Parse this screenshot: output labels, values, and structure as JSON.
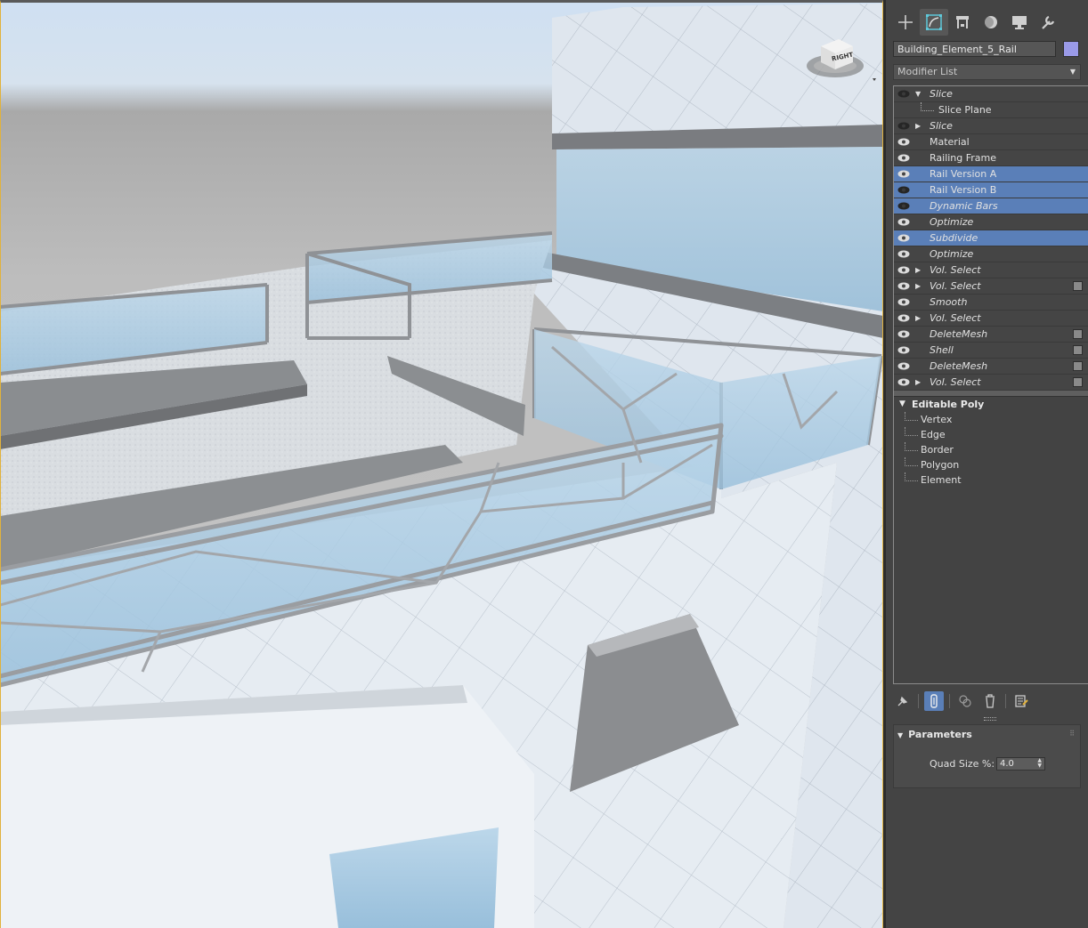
{
  "command_panel": {
    "tabs": [
      {
        "name": "create-tab",
        "icon": "plus-icon",
        "active": false
      },
      {
        "name": "modify-tab",
        "icon": "modify-icon",
        "active": true
      },
      {
        "name": "hierarchy-tab",
        "icon": "hierarchy-icon",
        "active": false
      },
      {
        "name": "motion-tab",
        "icon": "motion-icon",
        "active": false
      },
      {
        "name": "display-tab",
        "icon": "display-icon",
        "active": false
      },
      {
        "name": "utilities-tab",
        "icon": "wrench-icon",
        "active": false
      }
    ],
    "object_name": "Building_Element_5_Rail",
    "object_color": "#9a9ae8",
    "modifier_list_label": "Modifier List"
  },
  "modifier_stack": [
    {
      "label": "Slice",
      "italic": true,
      "eye": "off",
      "expander": "open",
      "selected": false,
      "checkbox": false
    },
    {
      "label": "Slice Plane",
      "italic": false,
      "sub": true
    },
    {
      "label": "Slice",
      "italic": true,
      "eye": "off",
      "expander": "closed",
      "selected": false,
      "checkbox": false
    },
    {
      "label": "Material",
      "italic": false,
      "eye": "on",
      "expander": "",
      "selected": false,
      "checkbox": false
    },
    {
      "label": "Railing Frame",
      "italic": false,
      "eye": "on",
      "expander": "",
      "selected": false,
      "checkbox": false
    },
    {
      "label": "Rail Version A",
      "italic": false,
      "eye": "on",
      "expander": "",
      "selected": true,
      "checkbox": false
    },
    {
      "label": "Rail Version B",
      "italic": false,
      "eye": "off",
      "expander": "",
      "selected": true,
      "checkbox": false
    },
    {
      "label": "Dynamic Bars",
      "italic": true,
      "eye": "off",
      "expander": "",
      "selected": true,
      "checkbox": false
    },
    {
      "label": "Optimize",
      "italic": true,
      "eye": "on",
      "expander": "",
      "selected": false,
      "checkbox": false
    },
    {
      "label": "Subdivide",
      "italic": true,
      "eye": "on",
      "expander": "",
      "selected": true,
      "checkbox": false
    },
    {
      "label": "Optimize",
      "italic": true,
      "eye": "on",
      "expander": "",
      "selected": false,
      "checkbox": false
    },
    {
      "label": "Vol. Select",
      "italic": true,
      "eye": "on",
      "expander": "closed",
      "selected": false,
      "checkbox": false
    },
    {
      "label": "Vol. Select",
      "italic": true,
      "eye": "on",
      "expander": "closed",
      "selected": false,
      "checkbox": true
    },
    {
      "label": "Smooth",
      "italic": true,
      "eye": "on",
      "expander": "",
      "selected": false,
      "checkbox": false
    },
    {
      "label": "Vol. Select",
      "italic": true,
      "eye": "on",
      "expander": "closed",
      "selected": false,
      "checkbox": false
    },
    {
      "label": "DeleteMesh",
      "italic": true,
      "eye": "on",
      "expander": "",
      "selected": false,
      "checkbox": true
    },
    {
      "label": "Shell",
      "italic": true,
      "eye": "on",
      "expander": "",
      "selected": false,
      "checkbox": true
    },
    {
      "label": "DeleteMesh",
      "italic": true,
      "eye": "on",
      "expander": "",
      "selected": false,
      "checkbox": true
    },
    {
      "label": "Vol. Select",
      "italic": true,
      "eye": "on",
      "expander": "closed",
      "selected": false,
      "checkbox": true
    }
  ],
  "base_object": {
    "label": "Editable Poly",
    "subobjects": [
      "Vertex",
      "Edge",
      "Border",
      "Polygon",
      "Element"
    ]
  },
  "stack_tools": [
    {
      "name": "pin-stack-button",
      "icon": "pin-icon",
      "active": false
    },
    {
      "name": "show-end-result-button",
      "icon": "show-end-result-icon",
      "active": true
    },
    {
      "name": "make-unique-button",
      "icon": "make-unique-icon",
      "active": false
    },
    {
      "name": "remove-modifier-button",
      "icon": "trash-icon",
      "active": false
    },
    {
      "name": "configure-modifier-sets-button",
      "icon": "configure-icon",
      "active": false
    }
  ],
  "parameters": {
    "title": "Parameters",
    "quad_size_label": "Quad Size %:",
    "quad_size_value": "4.0"
  },
  "viewcube": {
    "face_label": "RIGHT"
  }
}
